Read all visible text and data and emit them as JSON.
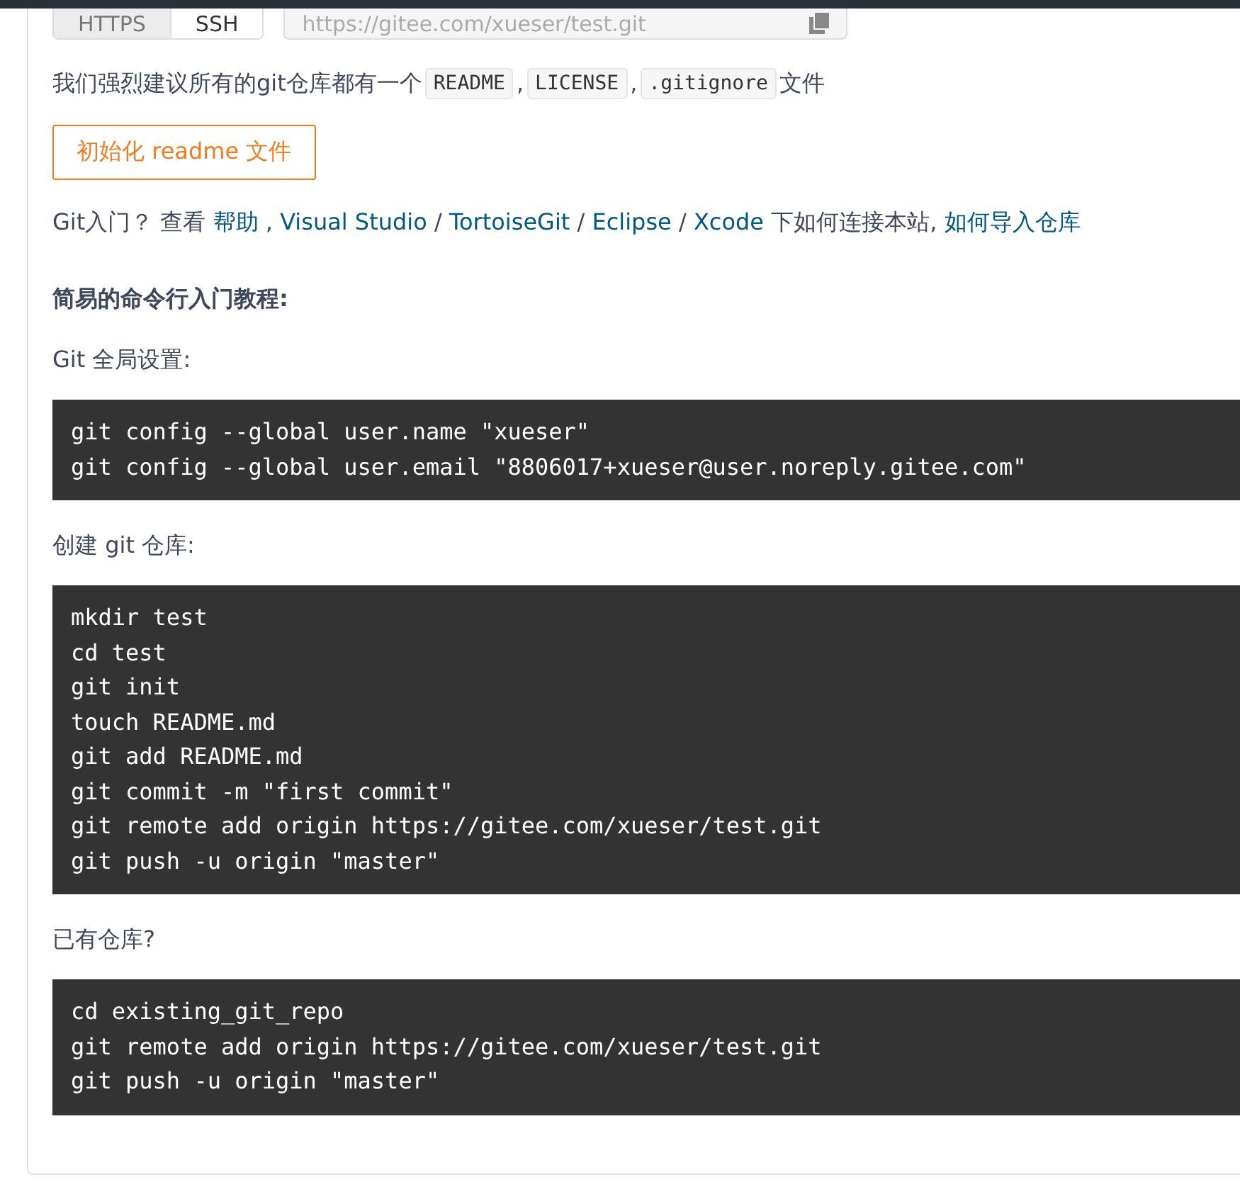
{
  "clone": {
    "tabs": [
      {
        "label": "HTTPS",
        "selected": false
      },
      {
        "label": "SSH",
        "selected": true
      }
    ],
    "url": {
      "value": "https://gitee.com/xueser/test.git"
    }
  },
  "recommend": {
    "parts": [
      {
        "kind": "text",
        "text": "我们强烈建议所有的git仓库都有一个"
      },
      {
        "kind": "code",
        "text": "README"
      },
      {
        "kind": "text",
        "text": ","
      },
      {
        "kind": "code",
        "text": "LICENSE"
      },
      {
        "kind": "text",
        "text": ","
      },
      {
        "kind": "code",
        "text": ".gitignore"
      },
      {
        "kind": "text",
        "text": "文件"
      }
    ]
  },
  "init_button": "初始化 readme 文件",
  "help": {
    "intro": "Git入门？ 查看 ",
    "links": [
      {
        "text": "帮助",
        "after": " , "
      },
      {
        "text": "Visual Studio",
        "after": " / "
      },
      {
        "text": "TortoiseGit",
        "after": " / "
      },
      {
        "text": "Eclipse",
        "after": " / "
      },
      {
        "text": "Xcode",
        "after": " 下如何连接本站, "
      },
      {
        "text": "如何导入仓库"
      }
    ]
  },
  "heading": "简易的命令行入门教程:",
  "sections": [
    {
      "label": "Git 全局设置:",
      "code": [
        "git config --global user.name \"xueser\"",
        "git config --global user.email \"8806017+xueser@user.noreply.gitee.com\""
      ]
    },
    {
      "label": "创建 git 仓库:",
      "code": [
        "mkdir test",
        "cd test",
        "git init",
        "touch README.md",
        "git add README.md",
        "git commit -m \"first commit\"",
        "git remote add origin https://gitee.com/xueser/test.git",
        "git push -u origin \"master\""
      ]
    },
    {
      "label": "已有仓库?",
      "code": [
        "cd existing_git_repo",
        "git remote add origin https://gitee.com/xueser/test.git",
        "git push -u origin \"master\""
      ]
    }
  ]
}
